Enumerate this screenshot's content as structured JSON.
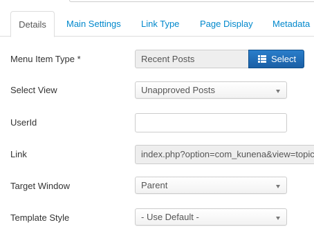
{
  "tabs": [
    {
      "label": "Details",
      "active": true
    },
    {
      "label": "Main Settings",
      "active": false
    },
    {
      "label": "Link Type",
      "active": false
    },
    {
      "label": "Page Display",
      "active": false
    },
    {
      "label": "Metadata",
      "active": false
    }
  ],
  "form": {
    "menu_item_type": {
      "label": "Menu Item Type *",
      "value": "Recent Posts",
      "button_label": "Select"
    },
    "select_view": {
      "label": "Select View",
      "value": "Unapproved Posts"
    },
    "user_id": {
      "label": "UserId",
      "value": ""
    },
    "link": {
      "label": "Link",
      "value": "index.php?option=com_kunena&view=topics&layout=user&mode=unapproved"
    },
    "target_window": {
      "label": "Target Window",
      "value": "Parent"
    },
    "template_style": {
      "label": "Template Style",
      "value": "- Use Default -"
    }
  },
  "icons": {
    "select_button": "list-icon",
    "dropdown": "caret-down-icon"
  },
  "colors": {
    "link": "#0088cc",
    "button": "#1f6bb6",
    "readonly_bg": "#eeeeee",
    "border": "#cccccc"
  }
}
